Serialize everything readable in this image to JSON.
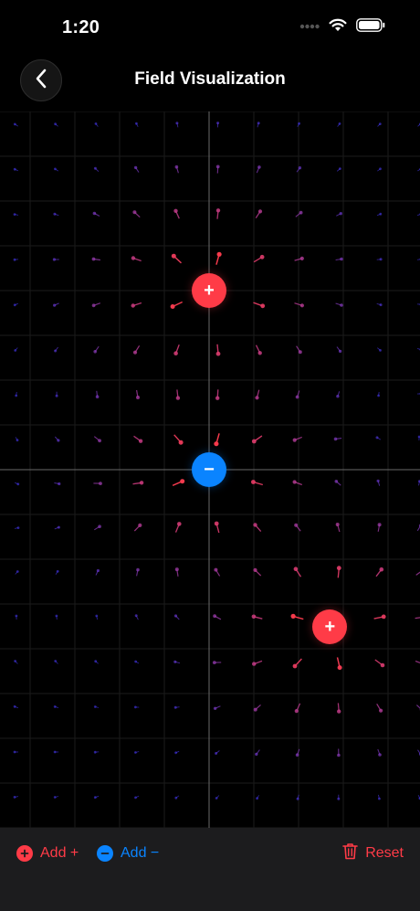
{
  "status": {
    "time": "1:20"
  },
  "nav": {
    "title": "Field Visualization"
  },
  "charges": [
    {
      "sign": "+",
      "q": 1,
      "gx": 5,
      "gy": 4
    },
    {
      "sign": "−",
      "q": -1,
      "gx": 5,
      "gy": 8
    },
    {
      "sign": "+",
      "q": 1,
      "gx": 7.7,
      "gy": 11.5
    }
  ],
  "toolbar": {
    "add_positive_label": "Add +",
    "add_negative_label": "Add −",
    "reset_label": "Reset"
  },
  "colors": {
    "positive": "#ff3b47",
    "negative": "#0a84ff",
    "field_near": "#ff3b47",
    "field_far": "#4a3cff",
    "toolbar_bg": "#1c1c1e"
  }
}
